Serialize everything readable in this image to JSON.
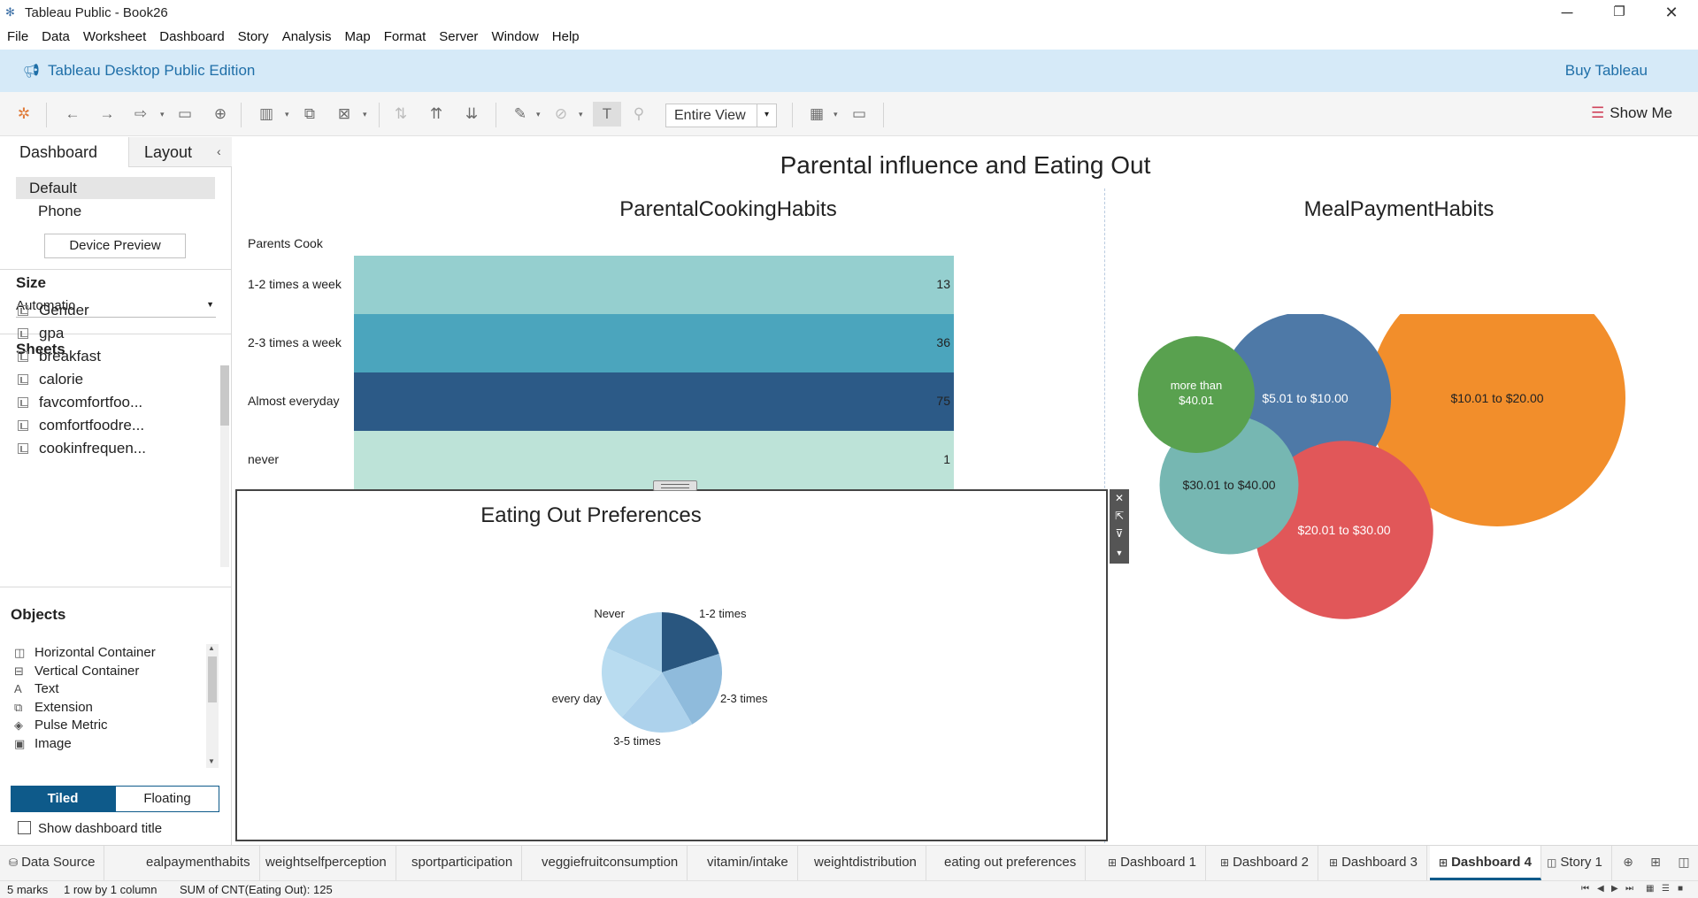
{
  "window": {
    "title": "Tableau Public - Book26",
    "controls": {
      "minimize": "─",
      "restore": "❐",
      "close": "✕"
    }
  },
  "menu": [
    "File",
    "Data",
    "Worksheet",
    "Dashboard",
    "Story",
    "Analysis",
    "Map",
    "Format",
    "Server",
    "Window",
    "Help"
  ],
  "banner": {
    "edition": "Tableau Desktop Public Edition",
    "buy": "Buy Tableau"
  },
  "toolbar": {
    "fit_value": "Entire View",
    "show_me": "Show Me"
  },
  "left_panel": {
    "tabs": {
      "dashboard": "Dashboard",
      "layout": "Layout"
    },
    "device": {
      "default": "Default",
      "phone": "Phone",
      "preview_button": "Device Preview"
    },
    "size": {
      "heading": "Size",
      "value": "Automatic"
    },
    "sheets": {
      "heading": "Sheets",
      "items": [
        "Gender",
        "gpa",
        "breakfast",
        "calorie",
        "favcomfortfoo...",
        "comfortfoodre...",
        "cookinfrequen..."
      ]
    },
    "objects": {
      "heading": "Objects",
      "items": [
        {
          "label": "Horizontal Container",
          "icon": "horizontal-container-icon",
          "glyph": "◫"
        },
        {
          "label": "Vertical Container",
          "icon": "vertical-container-icon",
          "glyph": "⊟"
        },
        {
          "label": "Text",
          "icon": "text-icon",
          "glyph": "A"
        },
        {
          "label": "Extension",
          "icon": "extension-icon",
          "glyph": "⧉"
        },
        {
          "label": "Pulse Metric",
          "icon": "pulse-metric-icon",
          "glyph": "◈"
        },
        {
          "label": "Image",
          "icon": "image-icon",
          "glyph": "▣"
        }
      ],
      "tiled": "Tiled",
      "floating": "Floating"
    },
    "show_title": "Show dashboard title"
  },
  "dashboard": {
    "title": "Parental influence and Eating Out",
    "parental": {
      "title": "ParentalCookingHabits",
      "column_header": "Parents Cook"
    },
    "pie": {
      "title": "Eating Out Preferences"
    },
    "bubbles": {
      "title": "MealPaymentHabits"
    }
  },
  "chart_data": [
    {
      "type": "bar",
      "title": "ParentalCookingHabits",
      "xlabel": "",
      "ylabel": "Parents Cook",
      "categories": [
        "1-2 times a week",
        "2-3 times a week",
        "Almost everyday",
        "never"
      ],
      "values": [
        13,
        36,
        75,
        1
      ],
      "colors": [
        "#95cfcf",
        "#4ba5bd",
        "#2c5a87",
        "#bde3d8"
      ]
    },
    {
      "type": "pie",
      "title": "Eating Out Preferences",
      "categories": [
        "1-2 times",
        "2-3 times",
        "3-5 times",
        "every day",
        "Never"
      ],
      "values": [
        25,
        27,
        25,
        25,
        23
      ],
      "colors": [
        "#29567f",
        "#8fbbdc",
        "#add2ec",
        "#b9dcf0",
        "#a9d1ea"
      ]
    },
    {
      "type": "bubble",
      "title": "MealPaymentHabits",
      "categories": [
        "$10.01 to $20.00",
        "$5.01 to $10.00",
        "$20.01 to $30.00",
        "$30.01 to $40.00",
        "more than $40.01"
      ],
      "values": [
        58,
        26,
        28,
        17,
        12
      ],
      "colors": [
        "#f28e2b",
        "#4e79a7",
        "#e15759",
        "#76b7b2",
        "#59a14f"
      ]
    }
  ],
  "sheet_tabs": [
    {
      "label": "Data Source",
      "icon": "⛁"
    },
    {
      "label": "ealpaymenthabits"
    },
    {
      "label": "weightselfperception"
    },
    {
      "label": "sportparticipation"
    },
    {
      "label": "veggiefruitconsumption"
    },
    {
      "label": "vitamin/intake"
    },
    {
      "label": "weightdistribution"
    },
    {
      "label": "eating out preferences"
    },
    {
      "label": "Dashboard 1",
      "icon": "⊞"
    },
    {
      "label": "Dashboard 2",
      "icon": "⊞"
    },
    {
      "label": "Dashboard 3",
      "icon": "⊞"
    },
    {
      "label": "Dashboard 4",
      "icon": "⊞",
      "active": true
    },
    {
      "label": "Story 1",
      "icon": "◫"
    }
  ],
  "status": {
    "marks": "5 marks",
    "rows": "1 row by 1 column",
    "sum": "SUM of CNT(Eating Out): 125"
  }
}
